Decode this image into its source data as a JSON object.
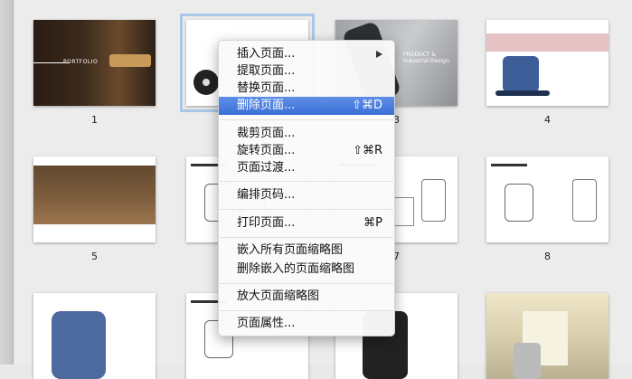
{
  "thumbnails": {
    "row1": [
      "1",
      "",
      "3",
      "4"
    ],
    "row2": [
      "5",
      "",
      "7",
      "8"
    ],
    "p1_title": "PORTFOLIO",
    "p3_title": "PRODUCT & Industrial Design"
  },
  "menu": {
    "items": [
      {
        "label": "插入页面...",
        "shortcut": "",
        "submenu": true
      },
      {
        "label": "提取页面...",
        "shortcut": ""
      },
      {
        "label": "替换页面...",
        "shortcut": ""
      },
      {
        "label": "删除页面...",
        "shortcut": "⇧⌘D",
        "highlighted": true
      },
      {
        "label": "裁剪页面...",
        "shortcut": ""
      },
      {
        "label": "旋转页面...",
        "shortcut": "⇧⌘R"
      },
      {
        "label": "页面过渡...",
        "shortcut": ""
      },
      {
        "label": "编排页码...",
        "shortcut": ""
      },
      {
        "label": "打印页面...",
        "shortcut": "⌘P"
      },
      {
        "label": "嵌入所有页面缩略图",
        "shortcut": ""
      },
      {
        "label": "删除嵌入的页面缩略图",
        "shortcut": ""
      },
      {
        "label": "放大页面缩略图",
        "shortcut": ""
      },
      {
        "label": "页面属性...",
        "shortcut": ""
      }
    ]
  },
  "colors": {
    "highlight": "#3a6fd6",
    "selection_outline": "#a9c6e6"
  }
}
